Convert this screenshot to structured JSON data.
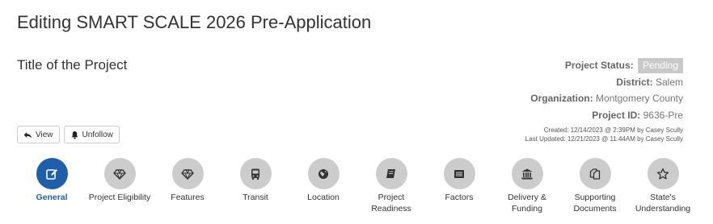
{
  "page": {
    "title": "Editing SMART SCALE 2026 Pre-Application"
  },
  "project": {
    "title": "Title of the Project",
    "status_label": "Project Status:",
    "status_value": "Pending",
    "district_label": "District:",
    "district_value": "Salem",
    "organization_label": "Organization:",
    "organization_value": "Montgomery County",
    "id_label": "Project ID:",
    "id_value": "9636-Pre",
    "created": "Created: 12/14/2023 @ 2:39PM by Casey Scully",
    "last_updated": "Last Updated: 12/21/2023 @ 11:44AM by Casey Scully"
  },
  "actions": {
    "view_label": "View",
    "unfollow_label": "Unfollow"
  },
  "colors": {
    "accent": "#1f5fa9",
    "inactive_circle": "#cccccc",
    "status_badge": "#c9c9c9"
  },
  "steps": [
    {
      "label": "General",
      "icon": "edit-icon",
      "active": true
    },
    {
      "label": "Project Eligibility",
      "icon": "diamond-icon",
      "active": false
    },
    {
      "label": "Features",
      "icon": "diamond-icon",
      "active": false
    },
    {
      "label": "Transit",
      "icon": "bus-icon",
      "active": false
    },
    {
      "label": "Location",
      "icon": "globe-icon",
      "active": false
    },
    {
      "label": "Project Readiness",
      "icon": "book-icon",
      "active": false
    },
    {
      "label": "Factors",
      "icon": "list-icon",
      "active": false
    },
    {
      "label": "Delivery & Funding",
      "icon": "bank-icon",
      "active": false
    },
    {
      "label": "Supporting Documents",
      "icon": "documents-icon",
      "active": false
    },
    {
      "label": "State's Understanding",
      "icon": "star-icon",
      "active": false
    }
  ]
}
